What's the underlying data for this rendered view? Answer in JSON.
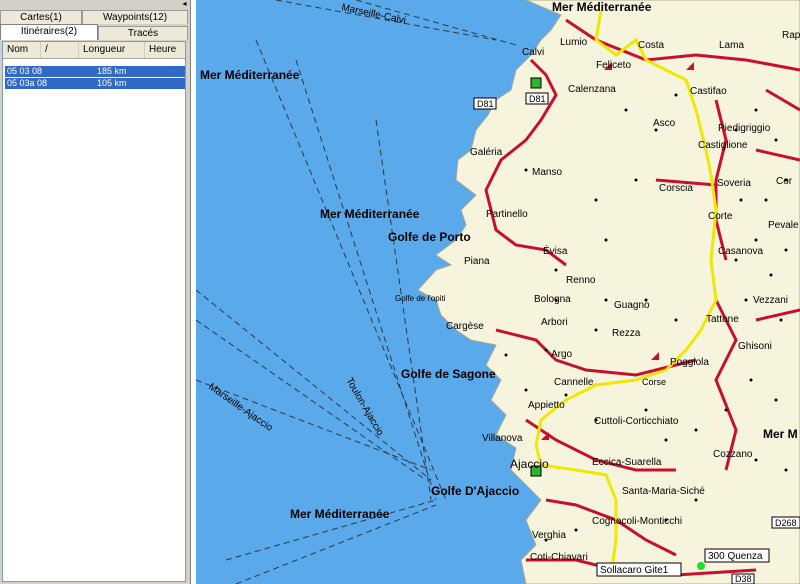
{
  "tabs": {
    "cartes": "Cartes(1)",
    "waypoints": "Waypoints(12)",
    "itineraires": "Itinéraires(2)",
    "traces": "Tracés"
  },
  "list": {
    "columns": [
      "Nom",
      "/",
      "Longueur",
      "Heure"
    ],
    "rows": [
      {
        "nom": "05 03 08",
        "longueur": "185 km",
        "heure": ""
      },
      {
        "nom": "05 03a 08",
        "longueur": "105 km",
        "heure": ""
      }
    ]
  },
  "map": {
    "sea_labels": [
      "Mer Méditerranée",
      "Mer Méditerranée",
      "Mer Méditerranée",
      "Mer Méditerranée",
      "Mer Méditerranée"
    ],
    "gulfs": [
      "Golfe de Porto",
      "Golfe de Sagone",
      "Golfe D'Ajaccio",
      "Golfe de l'opiti"
    ],
    "ferry_routes": [
      "Marseille-Calvi",
      "Marseille-Ajaccio",
      "Toulon-Ajaccio"
    ],
    "towns": {
      "calvi": "Calvi",
      "lumio": "Lumio",
      "costa": "Costa",
      "feliceto": "Feliceto",
      "calenzana": "Calenzana",
      "lama": "Lama",
      "rapale": "Rap",
      "castifao": "Castifao",
      "asco": "Asco",
      "piedigriggio": "Piedigriggio",
      "castiglione": "Castiglione",
      "galeria": "Galéria",
      "manso": "Manso",
      "corscia": "Corscia",
      "soveria": "Soveria",
      "corte": "Corte",
      "partinello": "Partinello",
      "evisa": "Évisa",
      "casanova": "Casanova",
      "piana": "Piana",
      "renno": "Renno",
      "vezzani": "Vezzani",
      "bologna": "Bologna",
      "guagno": "Guagno",
      "arbori": "Arbori",
      "rezza": "Rezza",
      "tattone": "Tattone",
      "ghisoni": "Ghisoni",
      "cargese": "Cargèse",
      "argo": "Argo",
      "poggiola": "Poggiola",
      "cannelle": "Cannelle",
      "corse": "Corse",
      "appietto": "Appietto",
      "cuttoli": "Cuttoli-Corticchiato",
      "villanova": "Villanova",
      "ajaccio": "Ajaccio",
      "eccica": "Eccica-Suarella",
      "cozzano": "Cozzano",
      "santamaria": "Santa-Maria-Siché",
      "cognocoli": "Cognocoli-Monticchi",
      "verghia": "Verghia",
      "coti": "Coti-Chiavari",
      "corte_e": "Cor",
      "pevale": "Pevale"
    },
    "top_label": "Mer Méditerranée",
    "roads": [
      "D81",
      "D81",
      "D268",
      "D38"
    ],
    "waypoints": {
      "sollacaro": "Sollacaro Gite1",
      "quenza": "300 Quenza"
    },
    "colors": {
      "sea": "#5aa9ea",
      "land": "#f7f4de",
      "road": "#c8102e",
      "route": "#f0e800"
    }
  }
}
